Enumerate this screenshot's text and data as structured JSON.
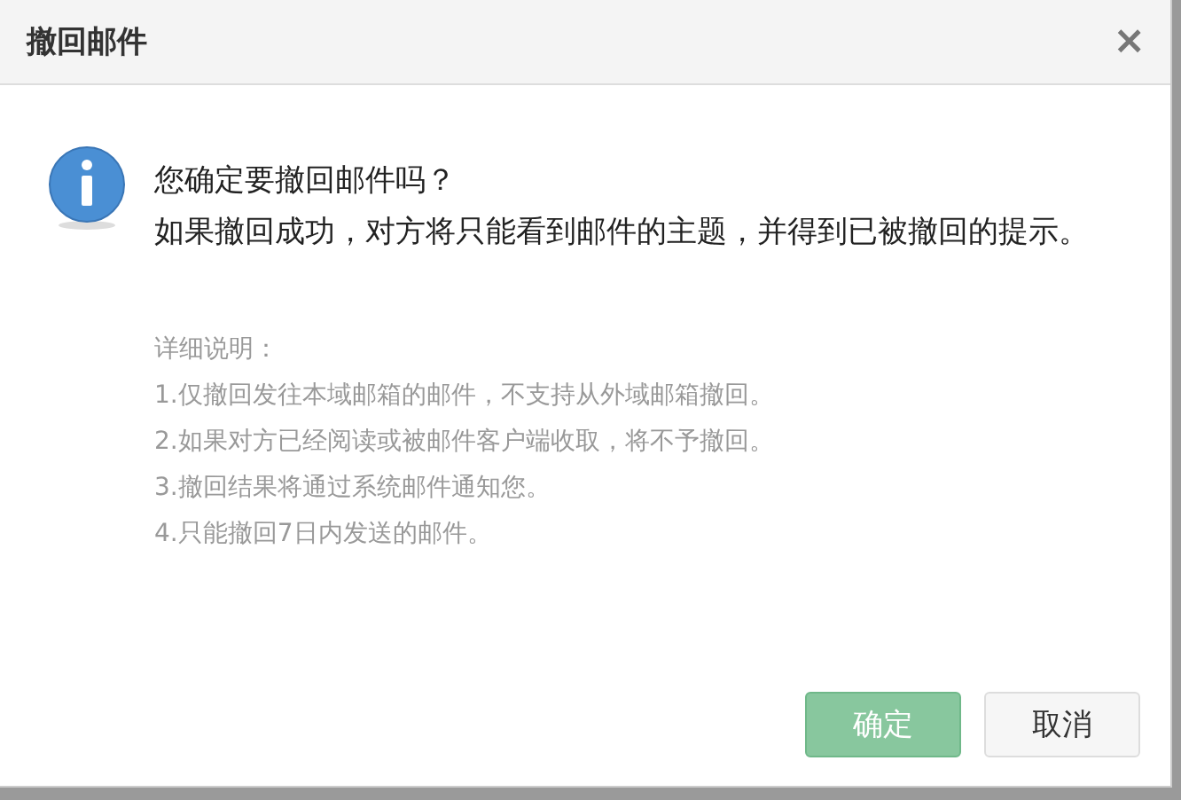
{
  "dialog": {
    "title": "撤回邮件",
    "close": "×",
    "message": [
      "您确定要撤回邮件吗？",
      "如果撤回成功，对方将只能看到邮件的主题，并得到已被撤回的提示。"
    ],
    "details": [
      "详细说明：",
      "1.仅撤回发往本域邮箱的邮件，不支持从外域邮箱撤回。",
      "2.如果对方已经阅读或被邮件客户端收取，将不予撤回。",
      "3.撤回结果将通过系统邮件通知您。",
      "4.只能撤回7日内发送的邮件。"
    ],
    "buttons": [
      {
        "label": "确定",
        "kind": "primary"
      },
      {
        "label": "取消",
        "kind": "default"
      }
    ]
  }
}
